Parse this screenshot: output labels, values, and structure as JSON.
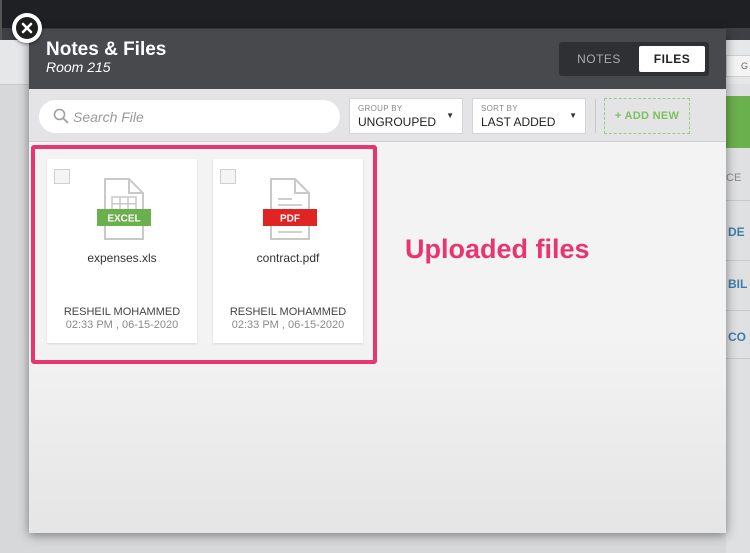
{
  "background": {
    "right_button_label": "G",
    "side_labels": [
      "DE",
      "BIL",
      "CO"
    ],
    "side_hint": "CE"
  },
  "modal": {
    "title": "Notes & Files",
    "subtitle": "Room 215",
    "tabs": [
      {
        "label": "NOTES",
        "active": false
      },
      {
        "label": "FILES",
        "active": true
      }
    ]
  },
  "toolbar": {
    "search": {
      "placeholder": "Search File",
      "value": ""
    },
    "group_by": {
      "label": "GROUP BY",
      "value": "UNGROUPED"
    },
    "sort_by": {
      "label": "SORT BY",
      "value": "LAST ADDED"
    },
    "add_new_label": "+ ADD NEW"
  },
  "files": [
    {
      "name": "expenses.xls",
      "type_badge": "EXCEL",
      "badge_color": "#6ab04c",
      "owner": "RESHEIL MOHAMMED",
      "date": "02:33 PM , 06-15-2020",
      "icon": "excel-file-icon"
    },
    {
      "name": "contract.pdf",
      "type_badge": "PDF",
      "badge_color": "#e02424",
      "owner": "RESHEIL MOHAMMED",
      "date": "02:33 PM , 06-15-2020",
      "icon": "pdf-file-icon"
    }
  ],
  "annotation": {
    "text": "Uploaded files",
    "color": "#e8346f"
  }
}
